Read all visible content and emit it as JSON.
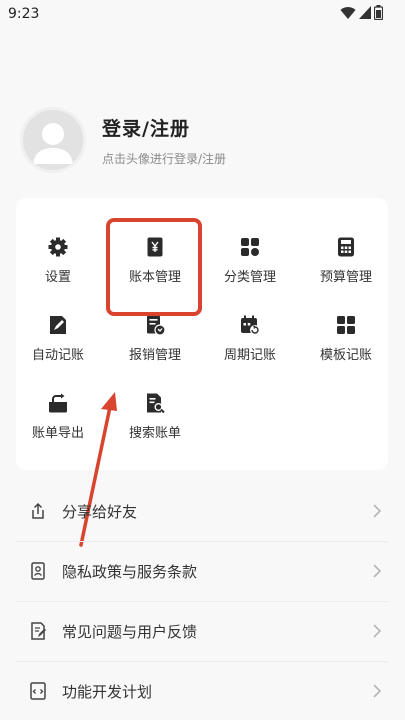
{
  "status_bar": {
    "time": "9:23",
    "icons": [
      "wifi-icon",
      "signal-icon",
      "battery-icon"
    ]
  },
  "profile": {
    "title": "登录/注册",
    "subtitle": "点击头像进行登录/注册"
  },
  "grid": {
    "items": [
      {
        "label": "设置",
        "icon": "gear-icon"
      },
      {
        "label": "账本管理",
        "icon": "ledger-yen-icon"
      },
      {
        "label": "分类管理",
        "icon": "category-grid-icon"
      },
      {
        "label": "预算管理",
        "icon": "calculator-icon"
      },
      {
        "label": "自动记账",
        "icon": "auto-pen-icon"
      },
      {
        "label": "报销管理",
        "icon": "reimburse-icon"
      },
      {
        "label": "周期记账",
        "icon": "calendar-repeat-icon"
      },
      {
        "label": "模板记账",
        "icon": "template-icon"
      },
      {
        "label": "账单导出",
        "icon": "export-icon"
      },
      {
        "label": "搜索账单",
        "icon": "search-bill-icon"
      }
    ]
  },
  "list": {
    "items": [
      {
        "label": "分享给好友",
        "icon": "share-icon"
      },
      {
        "label": "隐私政策与服务条款",
        "icon": "privacy-doc-icon"
      },
      {
        "label": "常见问题与用户反馈",
        "icon": "feedback-icon"
      },
      {
        "label": "功能开发计划",
        "icon": "dev-plan-icon"
      }
    ]
  },
  "colors": {
    "highlight": "#d9442f",
    "icon": "#2b2b2b",
    "background": "#f8f8f8",
    "card": "#ffffff"
  }
}
